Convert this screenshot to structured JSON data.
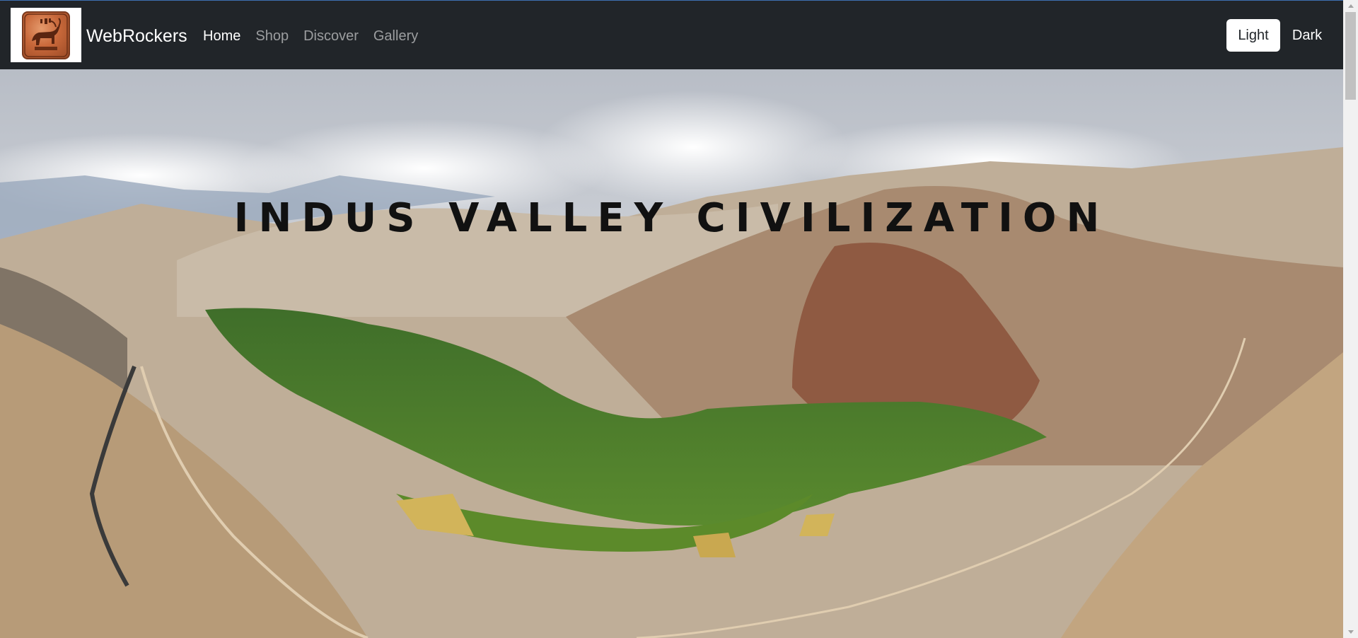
{
  "navbar": {
    "brand_name": "WebRockers",
    "links": [
      {
        "label": "Home",
        "active": true
      },
      {
        "label": "Shop",
        "active": false
      },
      {
        "label": "Discover",
        "active": false
      },
      {
        "label": "Gallery",
        "active": false
      }
    ],
    "theme_light_label": "Light",
    "theme_dark_label": "Dark"
  },
  "hero": {
    "title": "INDUS VALLEY CIVILIZATION"
  },
  "colors": {
    "navbar_bg": "#212529",
    "title_color": "#111111",
    "active_link": "#ffffff",
    "inactive_link": "rgba(255,255,255,0.55)"
  },
  "icons": {
    "logo": "bull-seal-icon"
  }
}
